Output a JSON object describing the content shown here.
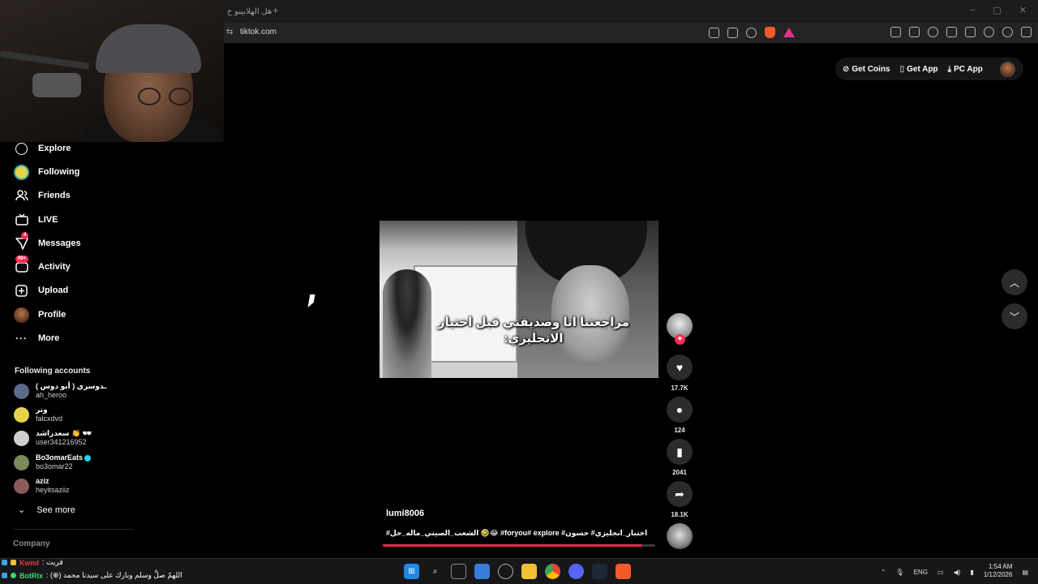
{
  "browser": {
    "tab_title": "هل الهلابينو ح",
    "new_tab": "+",
    "url": "tiktok.com",
    "window_controls": [
      "–",
      "▢",
      "✕"
    ]
  },
  "sidebar": {
    "items": [
      {
        "label": "Explore",
        "icon": "compass-icon"
      },
      {
        "label": "Following",
        "icon": "following-avatar-icon"
      },
      {
        "label": "Friends",
        "icon": "friends-icon"
      },
      {
        "label": "LIVE",
        "icon": "live-icon"
      },
      {
        "label": "Messages",
        "icon": "messages-icon",
        "badge": "4"
      },
      {
        "label": "Activity",
        "icon": "activity-icon",
        "badge": "99+"
      },
      {
        "label": "Upload",
        "icon": "upload-icon"
      },
      {
        "label": "Profile",
        "icon": "profile-avatar-icon"
      },
      {
        "label": "More",
        "icon": "more-icon"
      }
    ],
    "following_title": "Following accounts",
    "accounts": [
      {
        "name": "ـدوسري ( أبو دوس )",
        "username": "ah_heroo",
        "color": "#5a6a8a"
      },
      {
        "name": "وتر",
        "username": "falcxdvd",
        "color": "#e8d44a"
      },
      {
        "name": "سعدراشد 👏 🕶",
        "username": "user341216952",
        "color": "#cfcfcf"
      },
      {
        "name": "Bo3omarEats",
        "username": "bo3omar22",
        "color": "#7a8a5a",
        "verified": true
      },
      {
        "name": "aziz",
        "username": "heyitsaziiz",
        "color": "#8a5a5a"
      }
    ],
    "see_more": "See more",
    "company": "Company"
  },
  "topbar": {
    "get_coins": "Get Coins",
    "get_app": "Get App",
    "pc_app": "PC App"
  },
  "video": {
    "caption": "مراجعتنا انا وصديقتي قبل اختبار الانجليزي:",
    "username": "lumi8006",
    "description": "اختبار_انجليزي# حسون# foryou# explore# 😂🤣 الشعب_الصيني_ماله_حل#",
    "progress": 0.95,
    "likes": "17.7K",
    "comments": "124",
    "saves": "2041",
    "shares": "18.1K"
  },
  "chat": {
    "line1_name": "Kwml",
    "line1_msg": ": قريت",
    "line2_name": "BotRix",
    "line2_msg": ": (⊕) اللهمّ صلِّ وسلم وبارك على سيدنا محمد"
  },
  "taskbar": {
    "lang": "ENG",
    "time": "1:54 AM",
    "date": "1/12/2026",
    "tray_up": "⌃"
  },
  "colors": {
    "accent": "#fe2c55",
    "background": "#000000"
  }
}
